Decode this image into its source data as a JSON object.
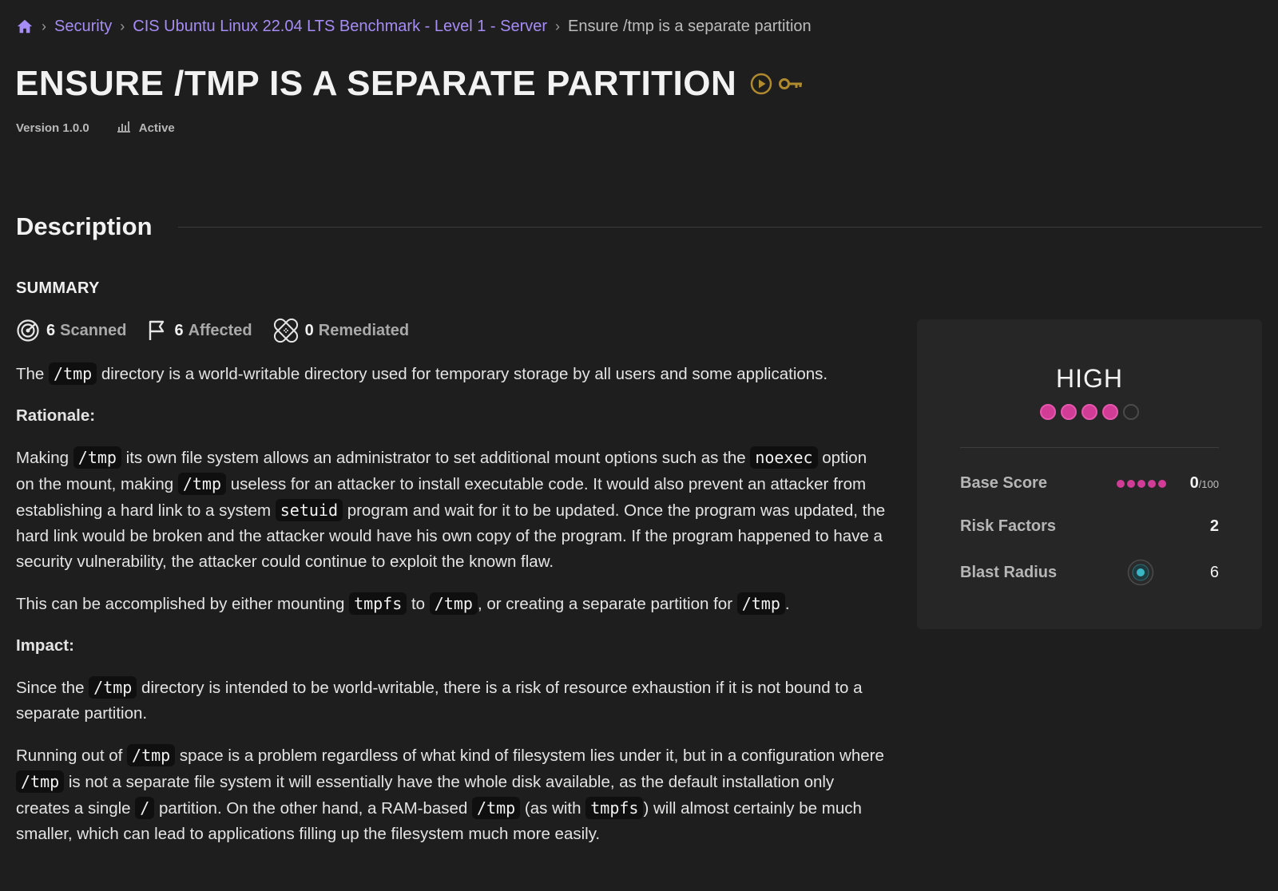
{
  "breadcrumb": {
    "items": [
      "Security",
      "CIS Ubuntu Linux 22.04 LTS Benchmark - Level 1 - Server"
    ],
    "current": "Ensure /tmp is a separate partition",
    "separator": "›"
  },
  "header": {
    "title": "ENSURE /TMP IS A SEPARATE PARTITION",
    "version": "Version 1.0.0",
    "status": "Active"
  },
  "section": {
    "title": "Description"
  },
  "summary": {
    "label": "SUMMARY",
    "stats": [
      {
        "count": "6",
        "label": "Scanned",
        "icon": "target-icon"
      },
      {
        "count": "6",
        "label": "Affected",
        "icon": "flag-icon"
      },
      {
        "count": "0",
        "label": "Remediated",
        "icon": "bandage-icon"
      }
    ]
  },
  "content": {
    "p1": {
      "t1": "The ",
      "c1": "/tmp",
      "t2": " directory is a world-writable directory used for temporary storage by all users and some applications."
    },
    "rationale_heading": "Rationale:",
    "p2": {
      "t1": "Making ",
      "c1": "/tmp",
      "t2": " its own file system allows an administrator to set additional mount options such as the ",
      "c2": "noexec",
      "t3": " option on the mount, making ",
      "c3": "/tmp",
      "t4": " useless for an attacker to install executable code. It would also prevent an attacker from establishing a hard link to a system ",
      "c4": "setuid",
      "t5": " program and wait for it to be updated. Once the program was updated, the hard link would be broken and the attacker would have his own copy of the program. If the program happened to have a security vulnerability, the attacker could continue to exploit the known flaw."
    },
    "p3": {
      "t1": "This can be accomplished by either mounting ",
      "c1": "tmpfs",
      "t2": " to ",
      "c2": "/tmp",
      "t3": ", or creating a separate partition for ",
      "c3": "/tmp",
      "t4": "."
    },
    "impact_heading": "Impact:",
    "p4": {
      "t1": "Since the ",
      "c1": "/tmp",
      "t2": " directory is intended to be world-writable, there is a risk of resource exhaustion if it is not bound to a separate partition."
    },
    "p5": {
      "t1": "Running out of ",
      "c1": "/tmp",
      "t2": " space is a problem regardless of what kind of filesystem lies under it, but in a configuration where ",
      "c2": "/tmp",
      "t3": " is not a separate file system it will essentially have the whole disk available, as the default installation only creates a single ",
      "c3": "/",
      "t4": " partition. On the other hand, a RAM-based ",
      "c4": "/tmp",
      "t5": " (as with ",
      "c5": "tmpfs",
      "t6": ") will almost certainly be much smaller, which can lead to applications filling up the filesystem much more easily."
    }
  },
  "score_card": {
    "severity": "HIGH",
    "severity_level": 4,
    "severity_max": 5,
    "base_score_label": "Base Score",
    "base_score": "0",
    "base_score_max": "/100",
    "risk_factors_label": "Risk Factors",
    "risk_factors": "2",
    "blast_radius_label": "Blast Radius",
    "blast_radius": "6"
  },
  "colors": {
    "accent": "#a68cf5",
    "severity": "#d13c96",
    "icon_gold": "#b08a2e",
    "blast_teal": "#3ab7c4",
    "background": "#1e1e1e",
    "card": "#262626"
  }
}
